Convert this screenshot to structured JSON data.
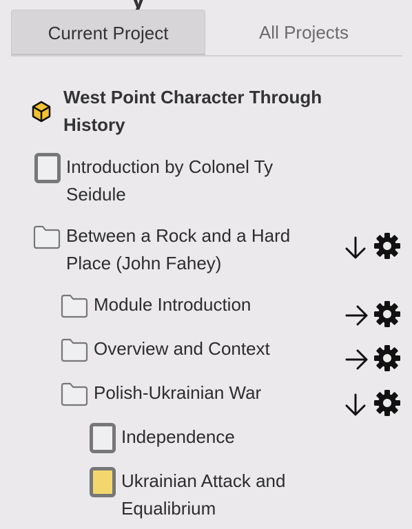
{
  "header": {
    "partial_title": "y"
  },
  "tabs": [
    {
      "label": "Current Project",
      "active": true
    },
    {
      "label": "All Projects",
      "active": false
    }
  ],
  "tree": {
    "project": {
      "title_line1": "West Point Character Through",
      "title_line2": "History",
      "icon": "cube-icon"
    },
    "items": [
      {
        "id": "intro",
        "type": "page",
        "line1": "Introduction by Colonel Ty",
        "line2": "Seidule",
        "state": "empty"
      },
      {
        "id": "rock",
        "type": "folder",
        "line1": "Between a Rock and a Hard",
        "line2": "Place (John Fahey)",
        "expand": "down"
      },
      {
        "id": "modintro",
        "type": "folder",
        "line1": "Module Introduction",
        "expand": "right"
      },
      {
        "id": "overview",
        "type": "folder",
        "line1": "Overview and Context",
        "expand": "right"
      },
      {
        "id": "polish",
        "type": "folder",
        "line1": "Polish-Ukrainian War",
        "expand": "down"
      },
      {
        "id": "independence",
        "type": "page",
        "line1": "Independence",
        "state": "empty"
      },
      {
        "id": "ukrainian",
        "type": "page",
        "line1": "Ukrainian Attack and",
        "line2": "Equalibrium",
        "state": "filled"
      }
    ]
  },
  "colors": {
    "page_filled": "#f3d76e",
    "cube": "#f2c230",
    "background": "#ebe9ec"
  }
}
